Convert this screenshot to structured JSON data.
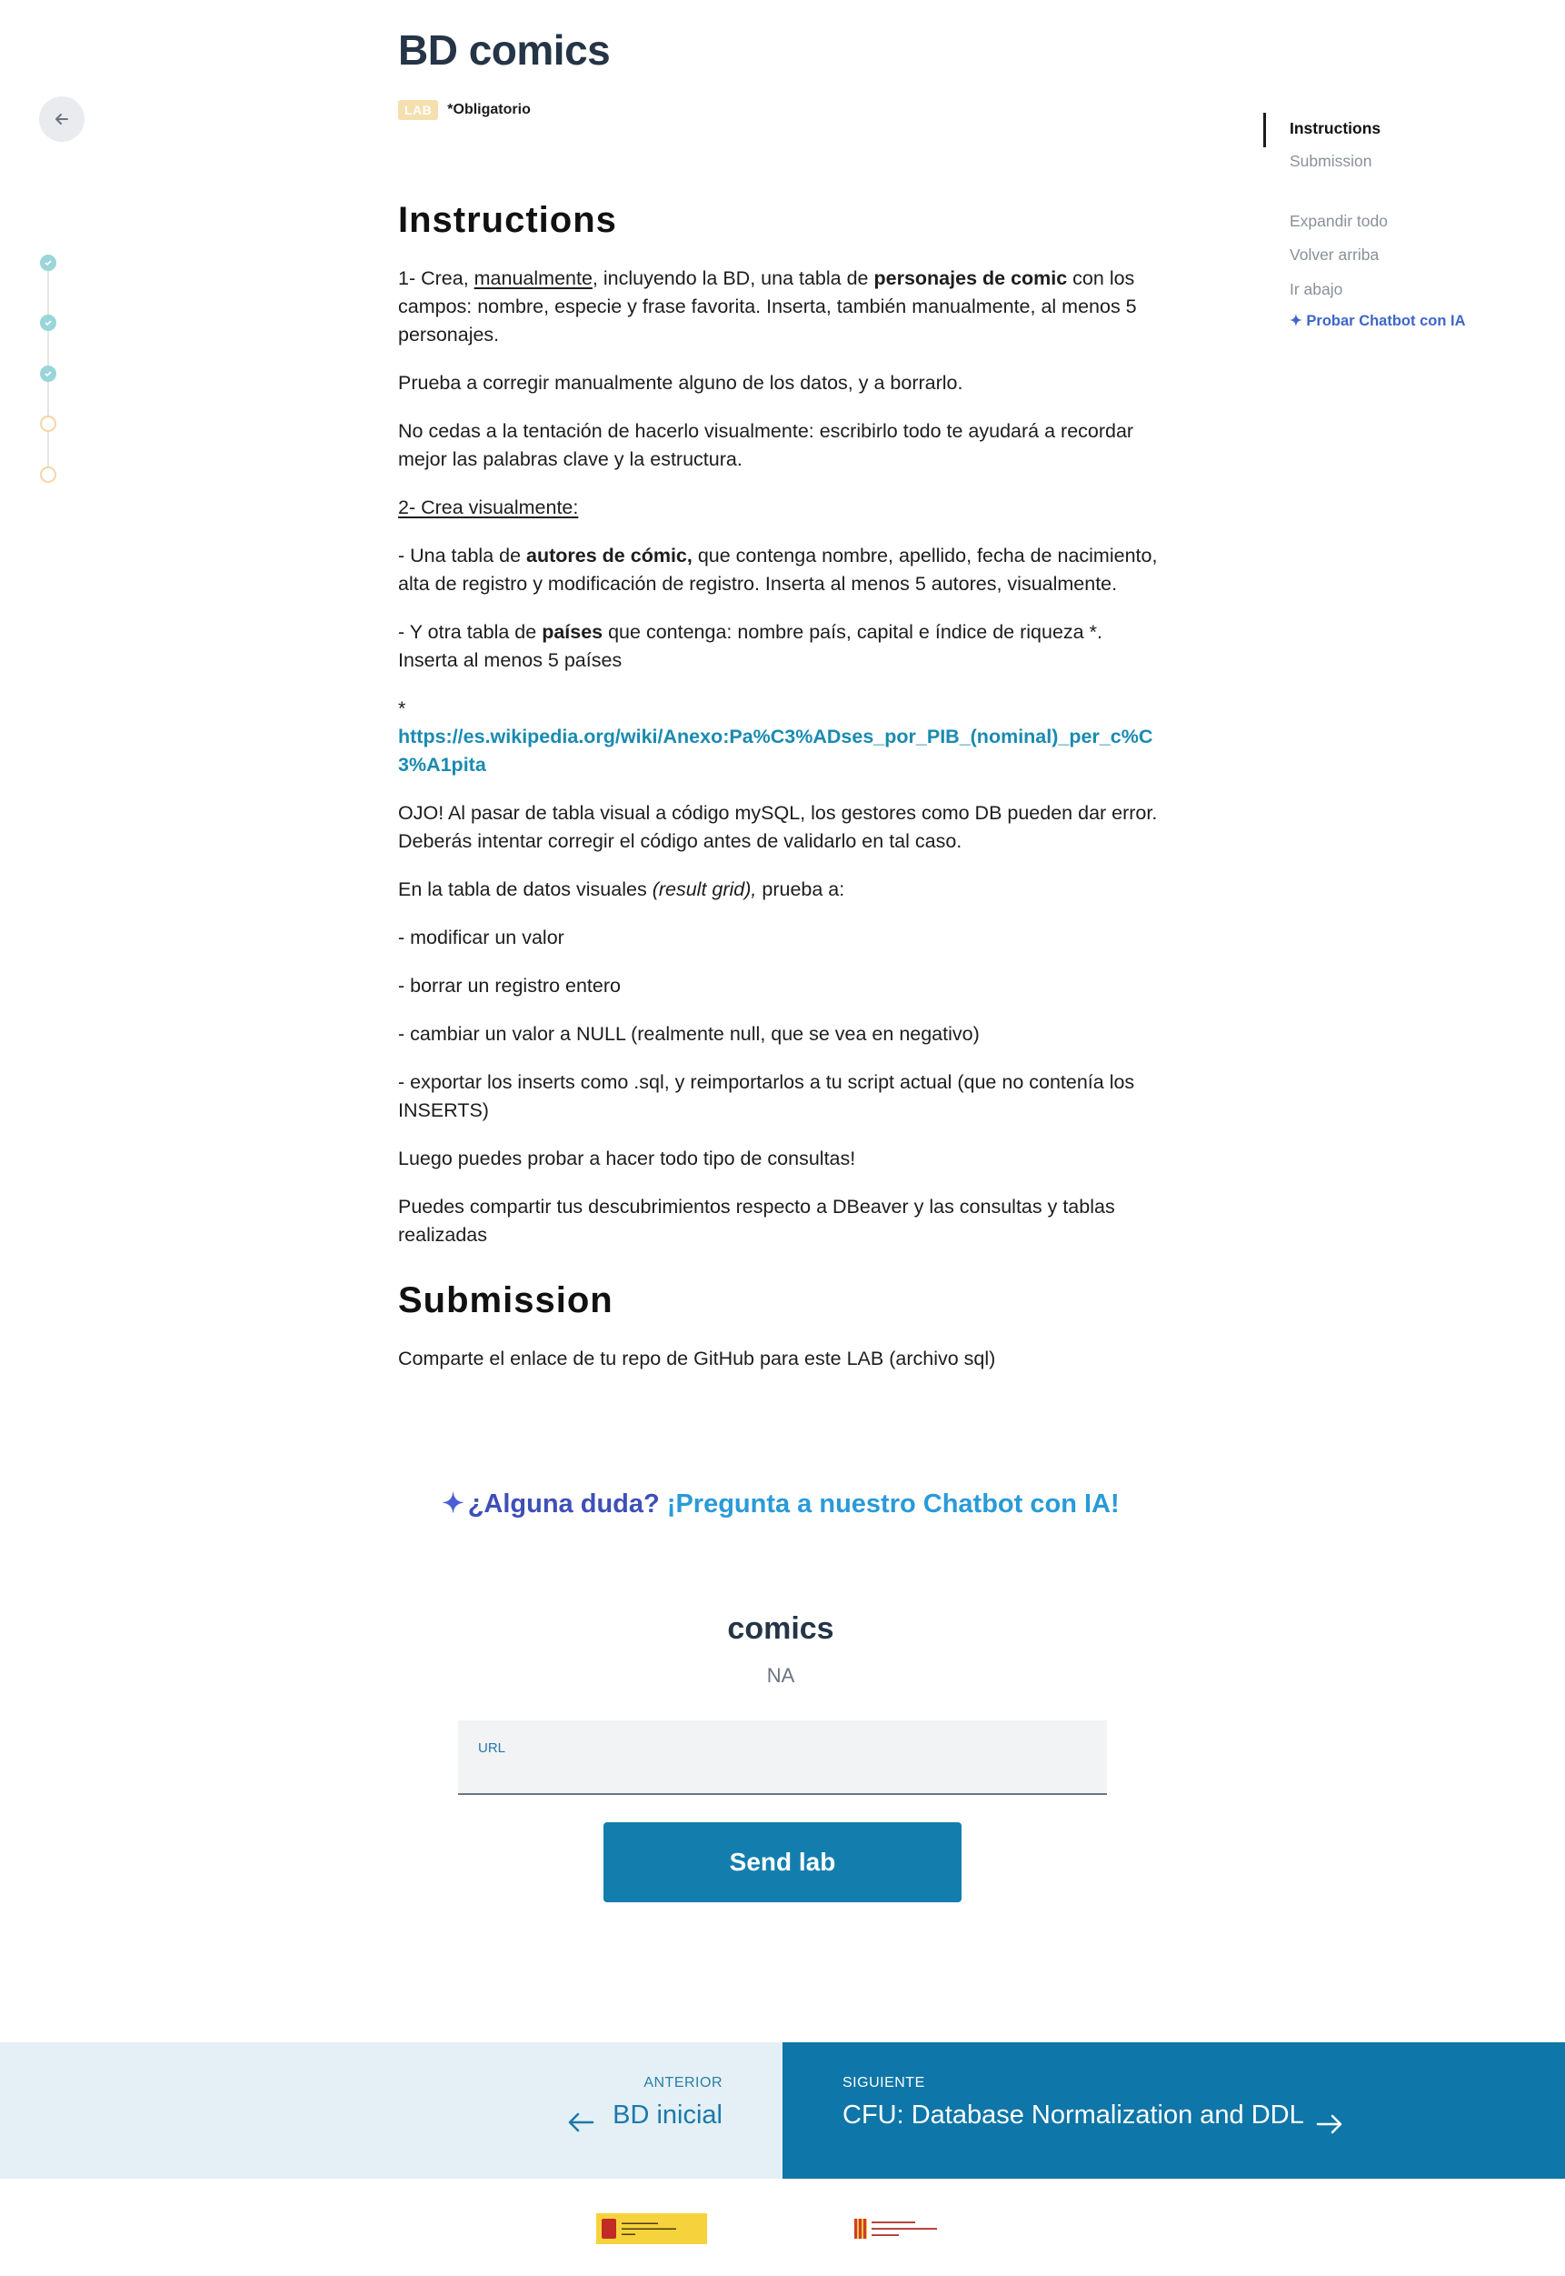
{
  "header": {
    "title": "BD comics",
    "badge": "LAB",
    "required": "*Obligatorio"
  },
  "toc": {
    "items": [
      {
        "label": "Instructions"
      },
      {
        "label": "Submission"
      },
      {
        "label": "Expandir todo"
      },
      {
        "label": "Volver arriba"
      },
      {
        "label": "Ir abajo"
      },
      {
        "label": "Probar Chatbot con IA"
      }
    ],
    "active": "Instructions"
  },
  "progress_steps": [
    {
      "state": "done"
    },
    {
      "state": "done"
    },
    {
      "state": "done"
    },
    {
      "state": "todo"
    },
    {
      "state": "todo"
    }
  ],
  "instructions": {
    "heading": "Instructions",
    "p1_a": "1- Crea, ",
    "p1_u": "manualmente",
    "p1_b": ", incluyendo la BD, una tabla de ",
    "p1_bold": "personajes de comic",
    "p1_c": " con los campos: nombre, especie y frase favorita. Inserta, también manualmente,  al menos 5 personajes.",
    "p2": "Prueba a corregir manualmente alguno de los datos, y a borrarlo.",
    "p3": "No cedas a la tentación de hacerlo visualmente: escribirlo todo te ayudará a recordar mejor las palabras clave y la estructura.",
    "p4": "2- Crea visualmente:",
    "p5_a": "- Una tabla de ",
    "p5_bold": "autores de cómic,",
    "p5_b": " que contenga nombre, apellido, fecha de nacimiento, alta de registro y modificación de registro. Inserta al menos 5 autores, visualmente.",
    "p6_a": "- Y otra tabla de ",
    "p6_bold": "países",
    "p6_b": " que contenga: nombre país, capital e índice de riqueza *. Inserta al menos 5 países",
    "p7_star": "*",
    "p7_link": "https://es.wikipedia.org/wiki/Anexo:Pa%C3%ADses_por_PIB_(nominal)_per_c%C3%A1pita",
    "p8": "OJO! Al pasar de tabla visual a código mySQL, los gestores como DB pueden dar error. Deberás intentar corregir el código antes de validarlo en tal caso.",
    "p9_a": "En la tabla de datos visuales ",
    "p9_i": "(result grid),",
    "p9_b": " prueba a:",
    "p10": "- modificar un valor",
    "p11": "- borrar un registro entero",
    "p12": "- cambiar un valor a NULL (realmente null, que se vea en negativo)",
    "p13": "- exportar los inserts como .sql, y reimportarlos a tu script actual (que no contenía los INSERTS)",
    "p14": "Luego puedes probar a hacer todo tipo de consultas!",
    "p15": "Puedes compartir tus descubrimientos respecto a DBeaver y  las consultas y tablas realizadas"
  },
  "submission": {
    "heading": "Submission",
    "text": "Comparte el enlace de tu repo de GitHub para este LAB (archivo sql)"
  },
  "chatbot": {
    "part1": "¿Alguna duda?",
    "part2": "¡Pregunta a nuestro Chatbot con IA!"
  },
  "form": {
    "title": "comics",
    "value": "NA",
    "url_label": "URL",
    "url_value": "",
    "send_label": "Send lab"
  },
  "nav": {
    "prev_kicker": "ANTERIOR",
    "prev_title": "BD inicial",
    "next_kicker": "SIGUIENTE",
    "next_title": "CFU: Database Normalization and DDL"
  },
  "colors": {
    "accent": "#137eae",
    "title": "#253447",
    "next_bg": "#0e76a8",
    "prev_bg": "#e4f0f6"
  }
}
